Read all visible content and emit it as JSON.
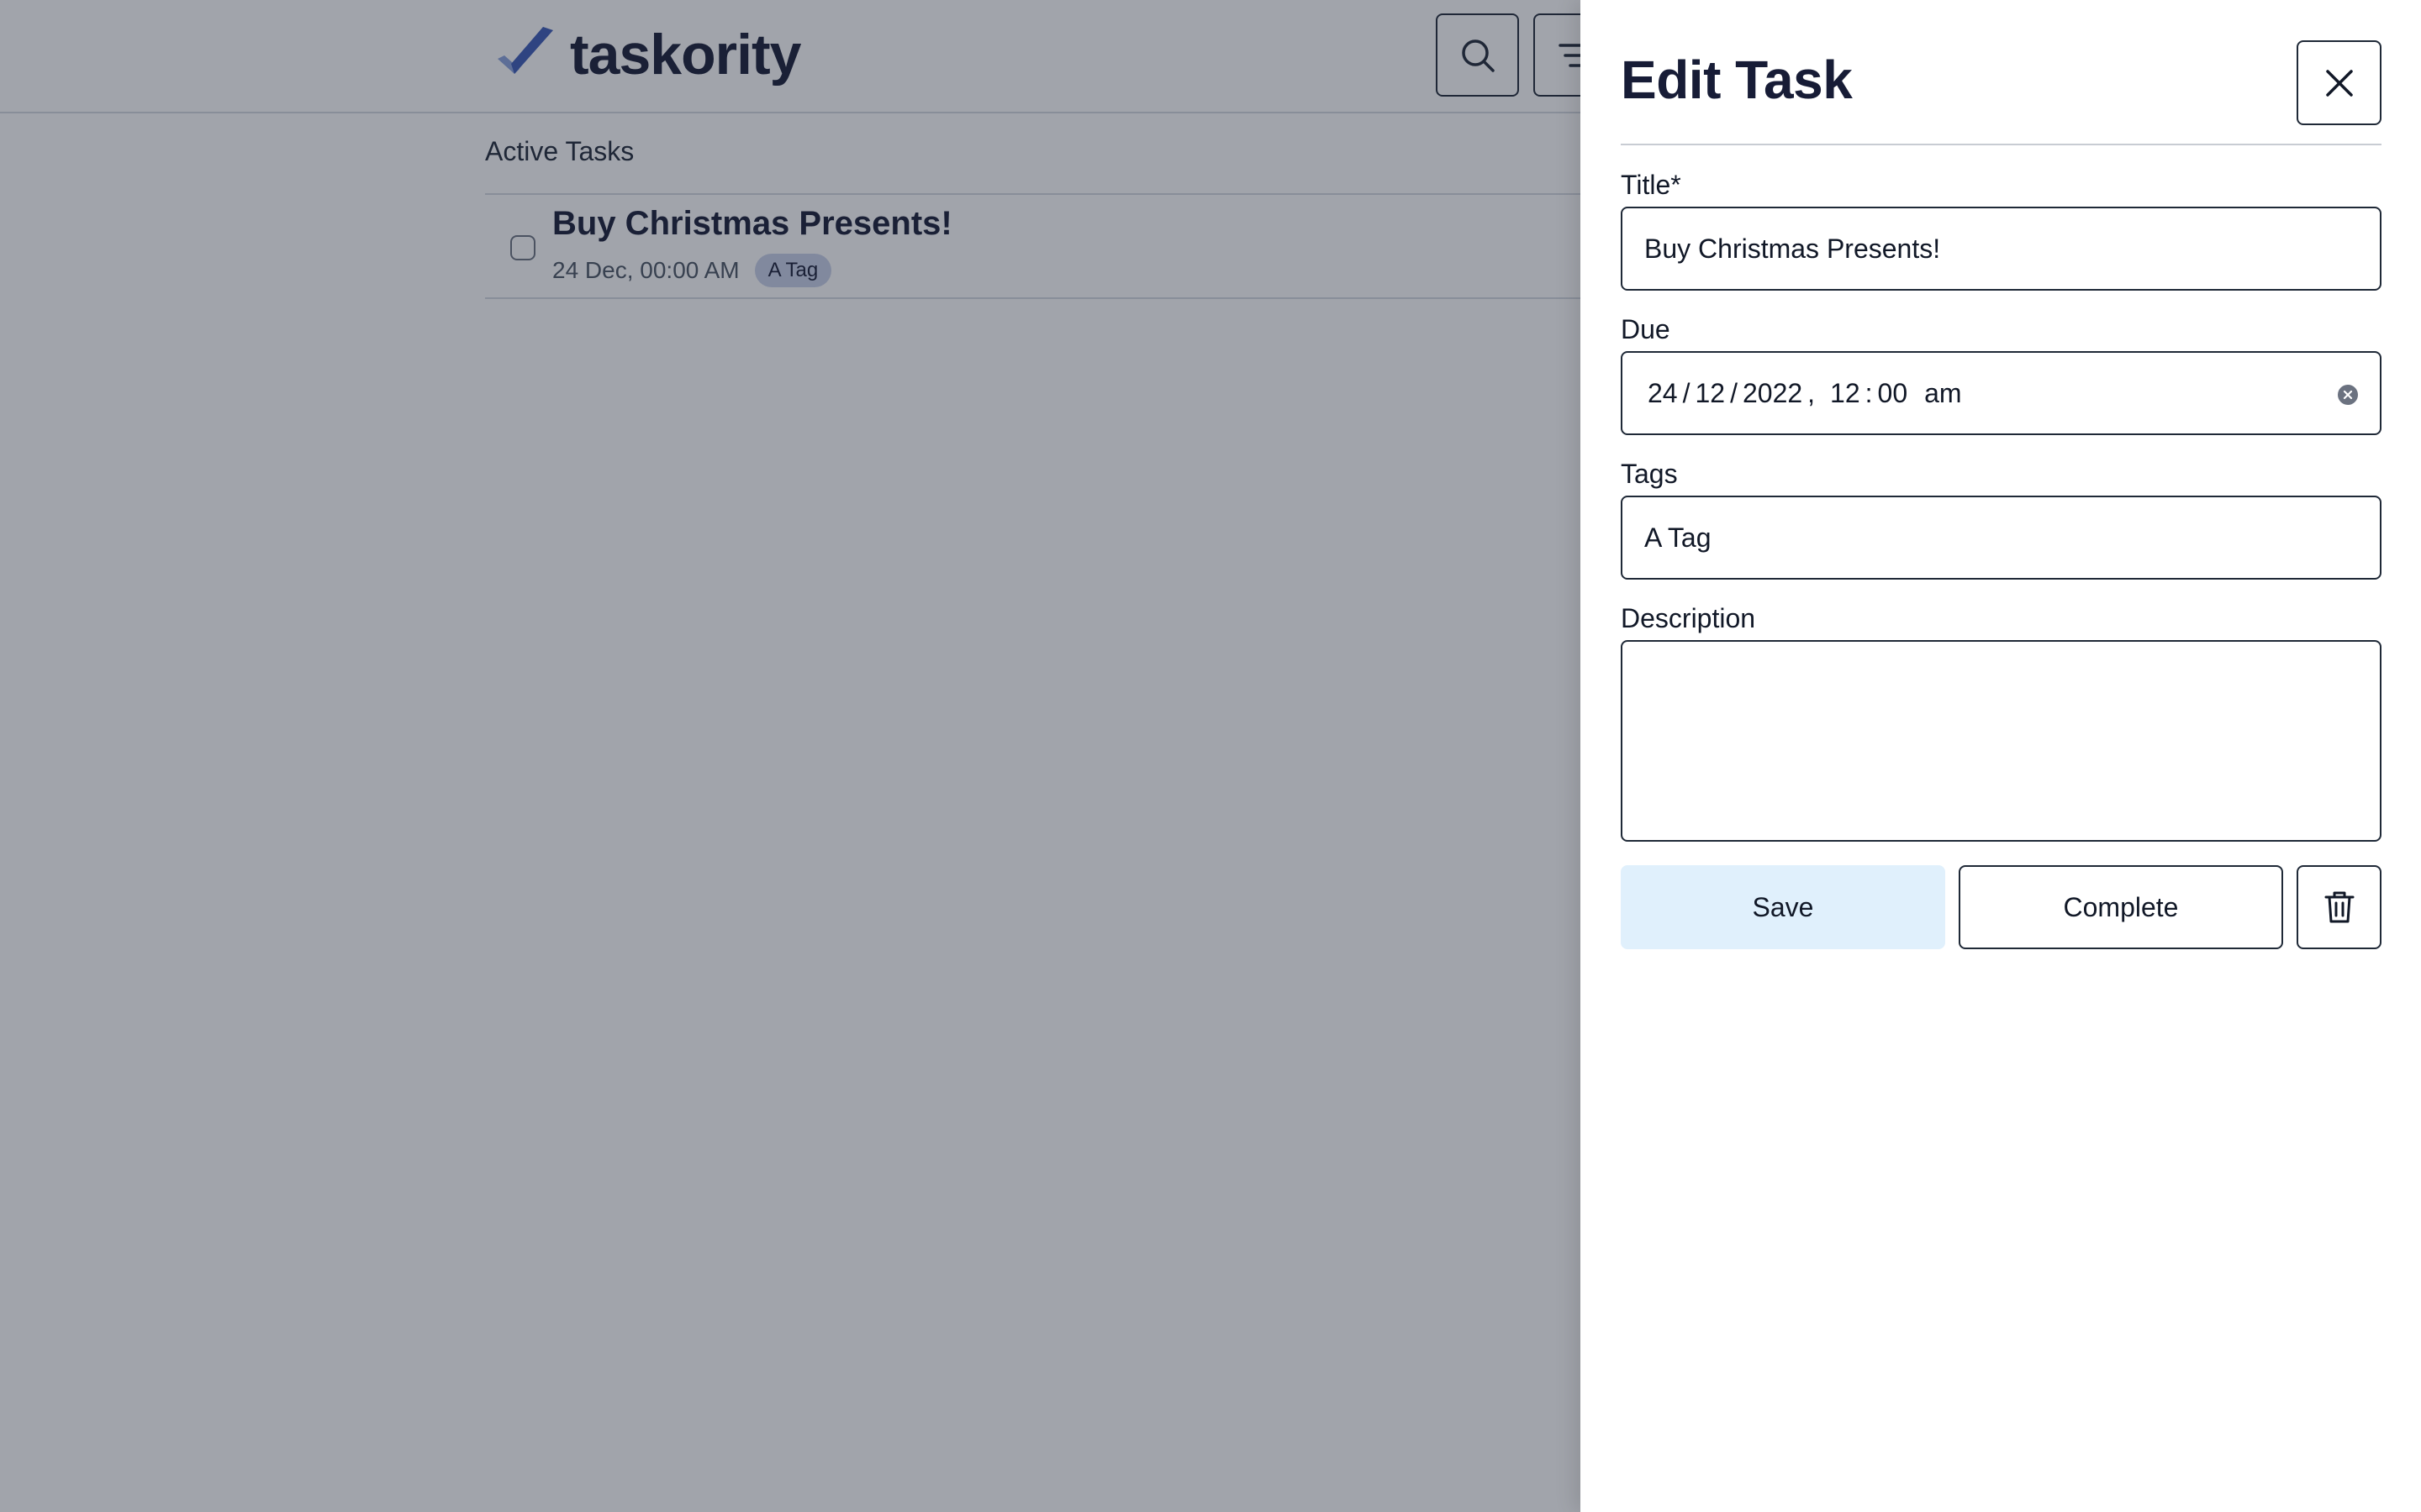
{
  "app": {
    "brand": "taskority",
    "section_title": "Active Tasks",
    "tasks": [
      {
        "title": "Buy Christmas Presents!",
        "due": "24 Dec, 00:00 AM",
        "tag": "A Tag"
      }
    ],
    "icons": {
      "logo": "checkmark-logo-icon",
      "search": "search-icon",
      "filter": "filter-icon"
    }
  },
  "drawer": {
    "title": "Edit Task",
    "fields": {
      "title_label": "Title*",
      "title_value": "Buy Christmas Presents!",
      "due_label": "Due",
      "due_day": "24",
      "due_month": "12",
      "due_year": "2022",
      "due_hour": "12",
      "due_minute": "00",
      "due_ampm": "am",
      "tags_label": "Tags",
      "tags_value": "A Tag",
      "description_label": "Description",
      "description_value": ""
    },
    "buttons": {
      "save": "Save",
      "complete": "Complete"
    },
    "icons": {
      "close": "close-icon",
      "delete": "trash-icon",
      "clear": "clear-circle-icon"
    }
  },
  "colors": {
    "brand_blue": "#3b5bb7",
    "brand_dark": "#171c36",
    "save_bg": "#e0f0fc",
    "tag_bg": "#c9d1e8"
  }
}
